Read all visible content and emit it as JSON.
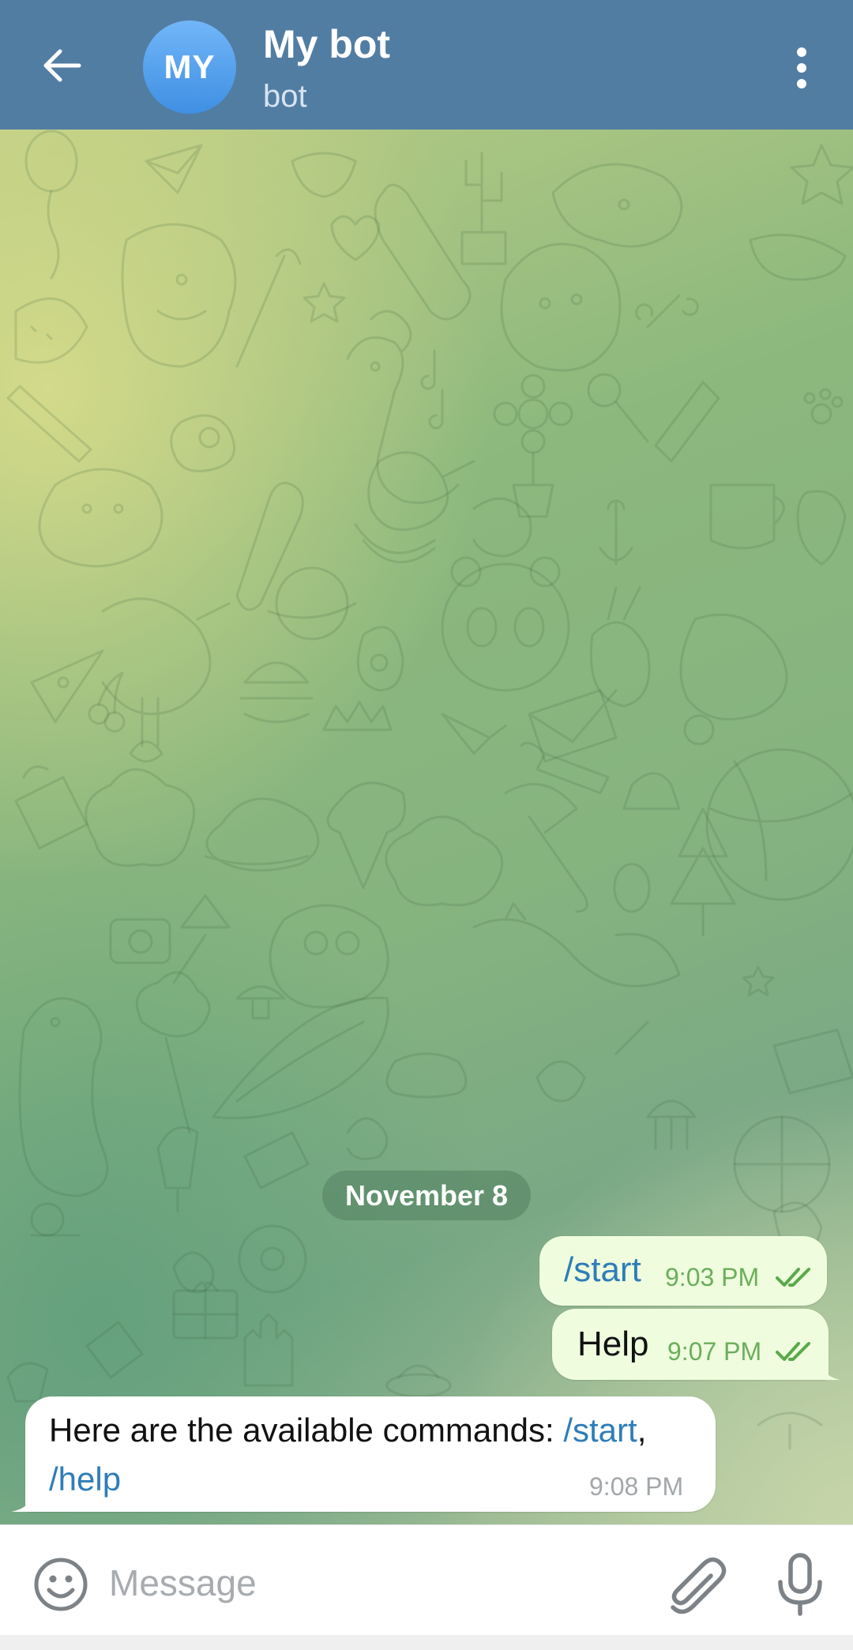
{
  "header": {
    "avatar_initials": "MY",
    "title": "My bot",
    "subtitle": "bot",
    "back_icon": "arrow-left-icon",
    "menu_icon": "more-vertical-icon",
    "background_color": "#527da3"
  },
  "chat": {
    "date_separator": "November 8",
    "messages": [
      {
        "direction": "outgoing",
        "text": "/start",
        "is_command": true,
        "time": "9:03 PM",
        "status": "read"
      },
      {
        "direction": "outgoing",
        "text": "Help",
        "is_command": false,
        "time": "9:07 PM",
        "status": "read"
      },
      {
        "direction": "incoming",
        "text_prefix": "Here are the available commands: ",
        "command_1": "/start",
        "separator": ", ",
        "command_2": "/help",
        "time": "9:08 PM"
      }
    ],
    "outgoing_bubble_color": "#effdde",
    "incoming_bubble_color": "#ffffff",
    "link_color": "#2e7db8"
  },
  "composer": {
    "placeholder": "Message",
    "emoji_icon": "smiley-icon",
    "attach_icon": "paperclip-icon",
    "mic_icon": "microphone-icon"
  }
}
